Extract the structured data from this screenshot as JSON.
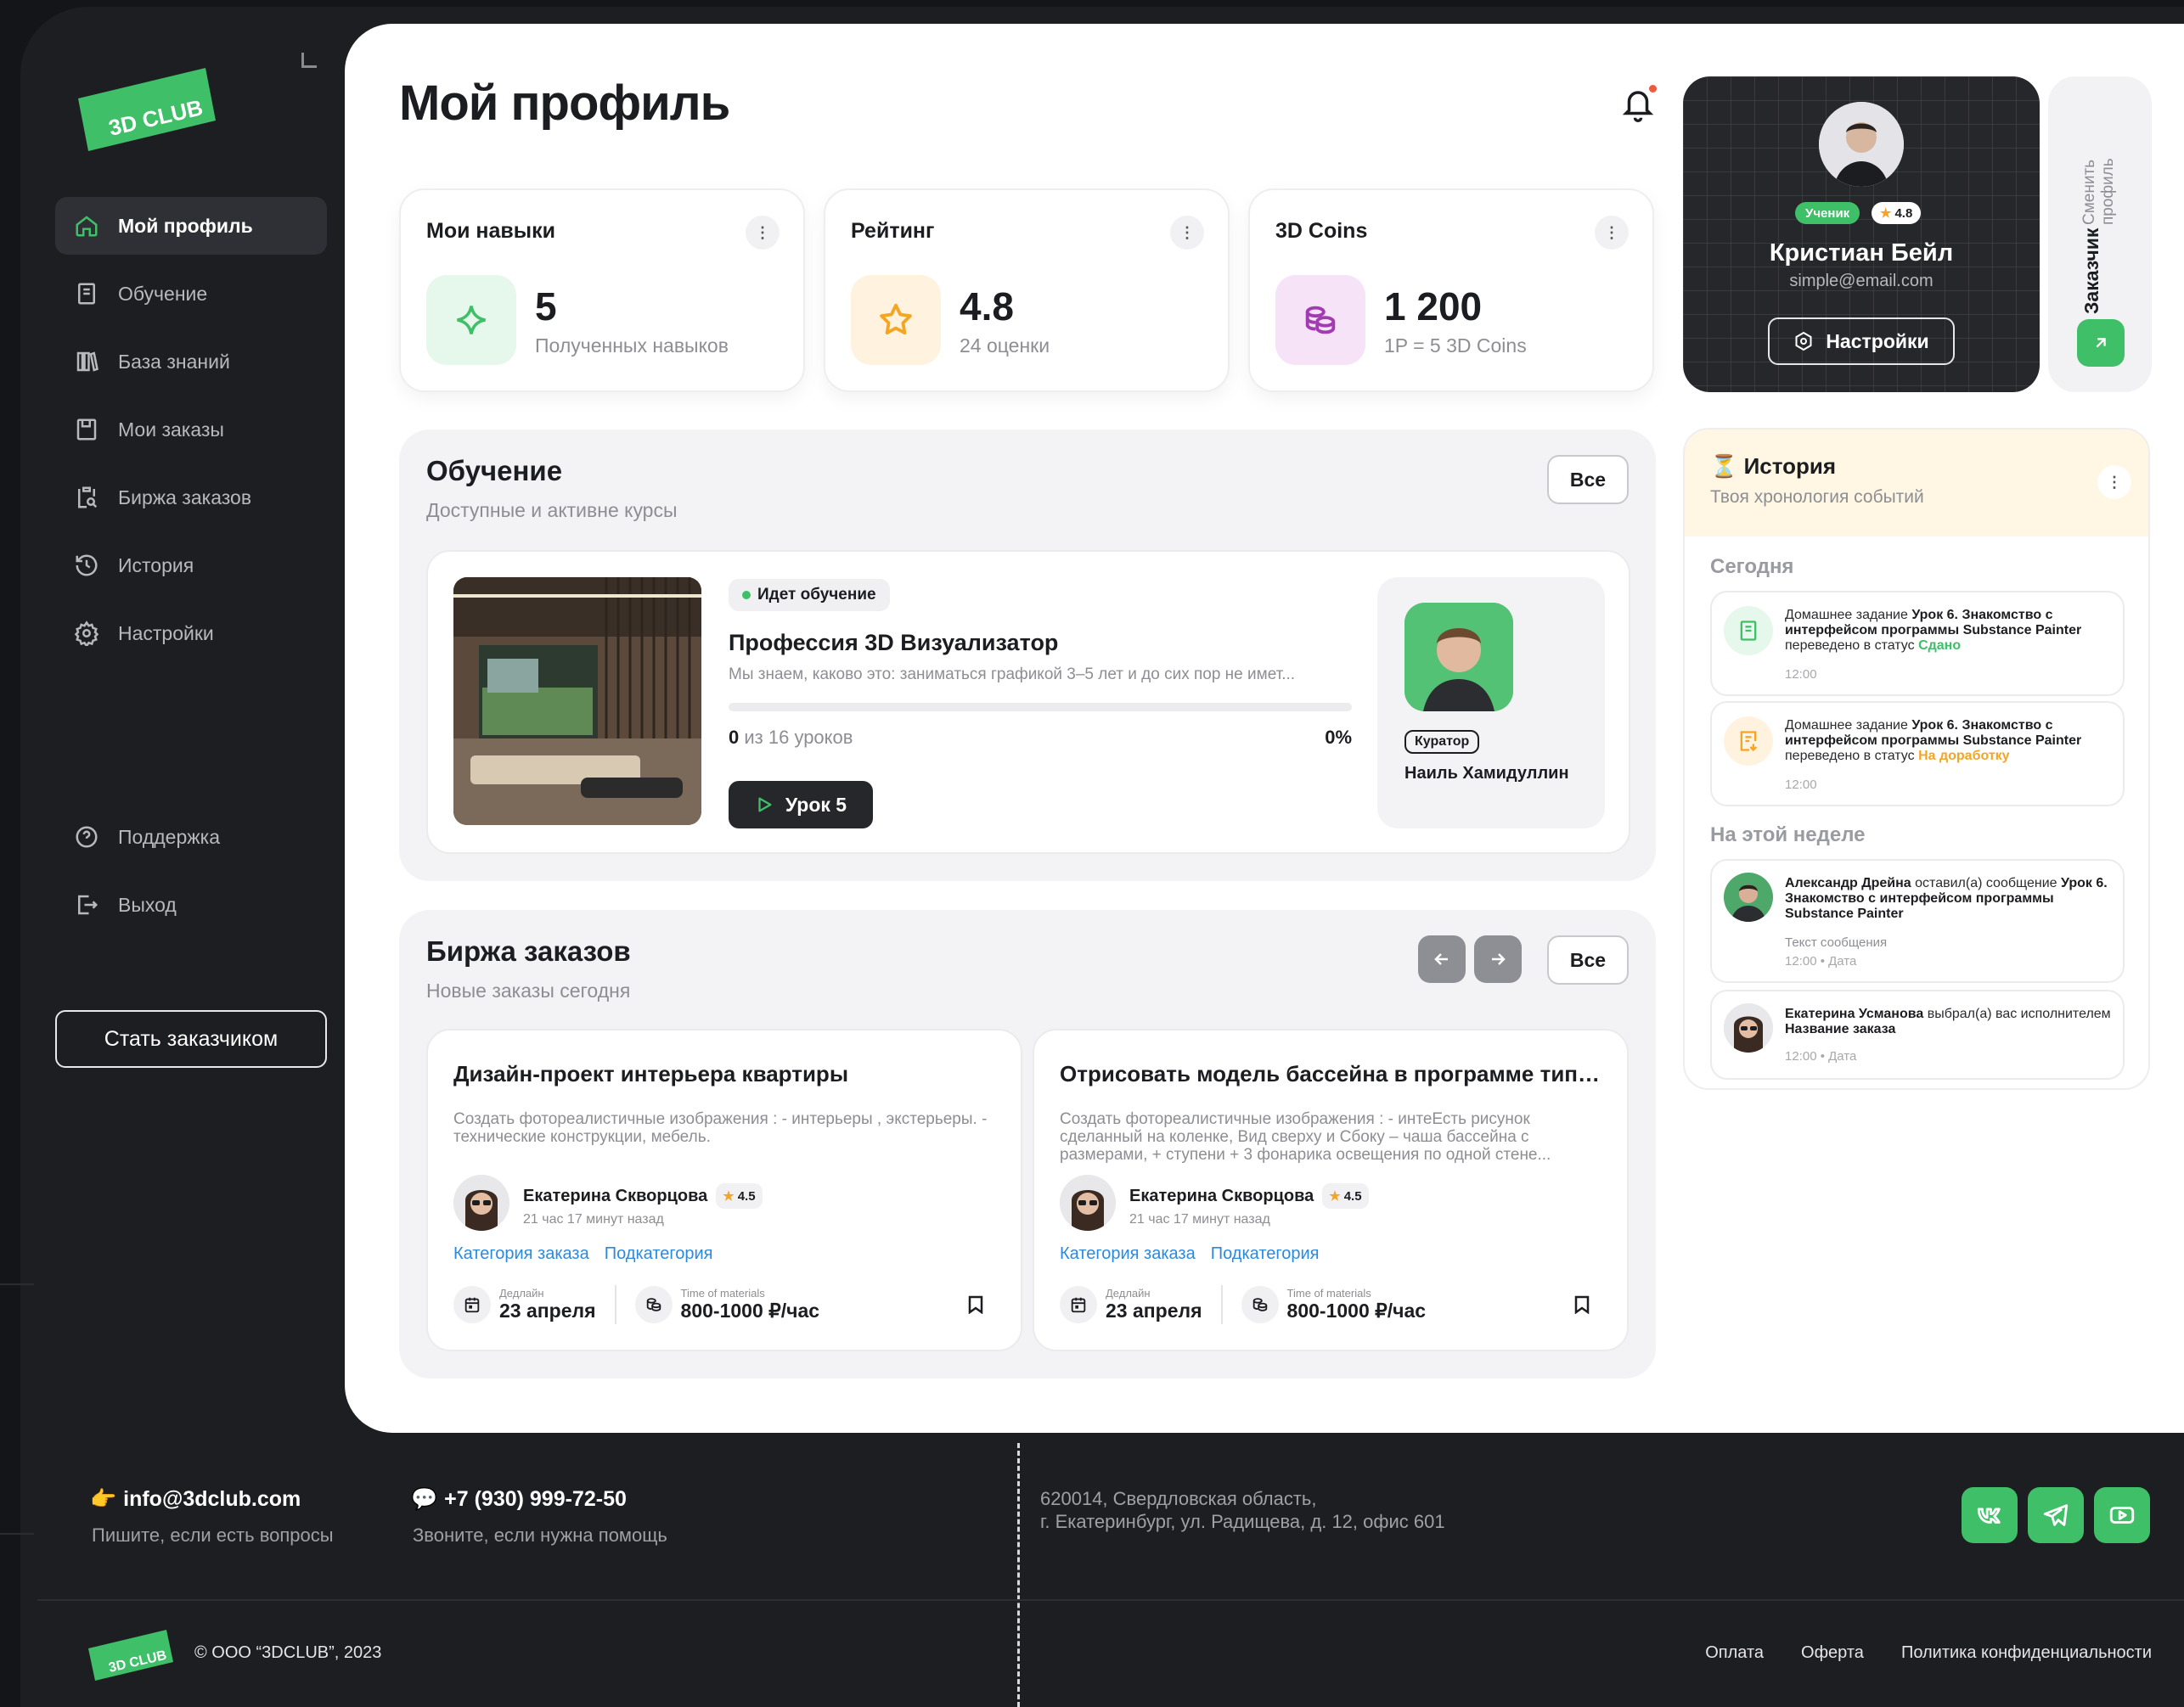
{
  "app": {
    "logo_text": "3D CLUB"
  },
  "sidebar": {
    "items": [
      {
        "label": "Мой профиль",
        "icon": "home-icon",
        "active": true
      },
      {
        "label": "Обучение",
        "icon": "book-icon"
      },
      {
        "label": "База знаний",
        "icon": "library-icon"
      },
      {
        "label": "Мои заказы",
        "icon": "save-icon"
      },
      {
        "label": "Биржа заказов",
        "icon": "clipboard-search-icon"
      },
      {
        "label": "История",
        "icon": "history-icon"
      },
      {
        "label": "Настройки",
        "icon": "gear-icon"
      }
    ],
    "bottom_items": [
      {
        "label": "Поддержка",
        "icon": "help-icon"
      },
      {
        "label": "Выход",
        "icon": "logout-icon"
      }
    ],
    "become_customer": "Стать заказчиком"
  },
  "header": {
    "title": "Мой профиль"
  },
  "stats": [
    {
      "title": "Мои навыки",
      "value": "5",
      "sub": "Полученных навыков",
      "icon": "sparkle-icon",
      "color": "#e6f7ec"
    },
    {
      "title": "Рейтинг",
      "value": "4.8",
      "sub": "24 оценки",
      "icon": "star-icon",
      "color": "#fff3df"
    },
    {
      "title": "3D Coins",
      "value": "1 200",
      "sub": "1P = 5 3D Coins",
      "icon": "coins-icon",
      "color": "#f6e3f7"
    }
  ],
  "profile": {
    "role_badge": "Ученик",
    "rating": "4.8",
    "name": "Кристиан Бейл",
    "email": "simple@email.com",
    "settings_label": "Настройки",
    "switch_title": "Заказчик",
    "switch_sub": "Сменить профиль"
  },
  "learning": {
    "title": "Обучение",
    "subtitle": "Доступные и активне курсы",
    "all_label": "Все",
    "course": {
      "status": "Идет обучение",
      "name": "Профессия 3D Визуализатор",
      "desc": "Мы знаем, каково это: заниматься графикой 3–5 лет и до сих пор не имет...",
      "done": "0",
      "total_text": "из 16 уроков",
      "percent": "0%",
      "progress": 0,
      "lesson_button": "Урок 5",
      "curator_badge": "Куратор",
      "curator_name": "Наиль Хамидуллин"
    }
  },
  "exchange": {
    "title": "Биржа заказов",
    "subtitle": "Новые заказы сегодня",
    "all_label": "Все",
    "orders": [
      {
        "title": "Дизайн-проект интерьера квартиры",
        "desc": "Создать фотореалистичные изображения : - интерьеры , экстерьеры. - технические конструкции, мебель.",
        "author": "Екатерина Скворцова",
        "rating": "4.5",
        "time": "21 час 17 минут назад",
        "category": "Категория заказа",
        "subcategory": "Подкатегория",
        "deadline_label": "Дедлайн",
        "deadline": "23 апреля",
        "rate_label": "Time of materials",
        "rate": "800-1000 ₽/час"
      },
      {
        "title": "Отрисовать модель бассейна в программе типа...",
        "desc": "Создать фотореалистичные изображения : - интеЕсть рисунок сделанный на коленке, Вид сверху и Сбоку – чаша бассейна с размерами, + ступени + 3 фонарика освещения по одной стене...",
        "author": "Екатерина Скворцова",
        "rating": "4.5",
        "time": "21 час 17 минут назад",
        "category": "Категория заказа",
        "subcategory": "Подкатегория",
        "deadline_label": "Дедлайн",
        "deadline": "23 апреля",
        "rate_label": "Time of materials",
        "rate": "800-1000 ₽/час"
      }
    ]
  },
  "history": {
    "emoji": "⏳",
    "title": "История",
    "subtitle": "Твоя хронология событий",
    "today_label": "Сегодня",
    "week_label": "На этой неделе",
    "items": [
      {
        "pre": "Домашнее задание ",
        "bold": "Урок 6. Знакомство с интерфейсом программы Substance Painter",
        "mid": " переведено в статус ",
        "status": "Сдано",
        "time": "12:00"
      },
      {
        "pre": "Домашнее задание ",
        "bold": "Урок 6. Знакомство с интерфейсом программы Substance Painter",
        "mid": " переведено в статус ",
        "status": "На доработку",
        "time": "12:00"
      },
      {
        "author": "Александр Дрейна",
        "action": " оставил(а) сообщение ",
        "bold": "Урок 6. Знакомство с интерфейсом программы Substance Painter",
        "message": "Текст сообщения",
        "time": "12:00",
        "date": "Дата"
      },
      {
        "author": "Екатерина Усманова",
        "action": " выбрал(а) вас исполнителем ",
        "bold": "Название заказа",
        "time": "12:00",
        "date": "Дата"
      }
    ]
  },
  "footer": {
    "email_emoji": "👉",
    "email": "info@3dclub.com",
    "email_sub": "Пишите, если есть вопросы",
    "phone_emoji": "💬",
    "phone": "+7 (930) 999-72-50",
    "phone_sub": "Звоните, если нужна помощь",
    "address_line1": "620014, Свердловская область,",
    "address_line2": "г. Екатеринбург, ул. Радищева, д. 12, офис 601",
    "copyright": "© ООО “3DCLUB”, 2023",
    "links": [
      "Оплата",
      "Оферта",
      "Политика конфиденциальности"
    ],
    "socials": [
      "vk-icon",
      "telegram-icon",
      "youtube-icon"
    ]
  },
  "colors": {
    "accent": "#3fbf67",
    "dark": "#1d1e22",
    "warning": "#f5a524",
    "link": "#2a8ae0"
  }
}
